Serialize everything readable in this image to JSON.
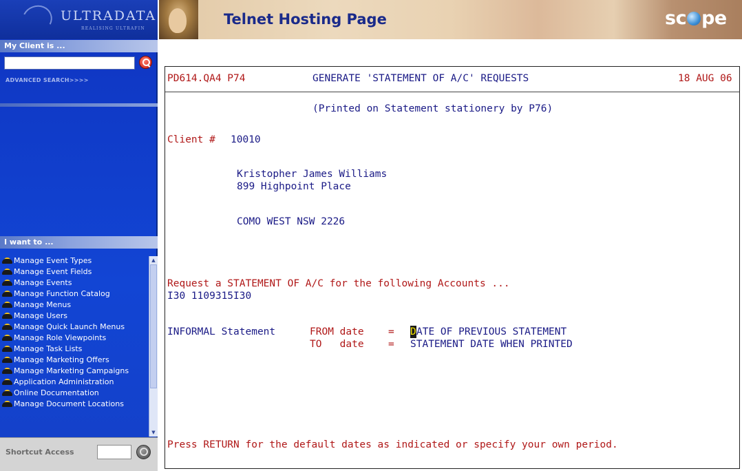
{
  "sidebar": {
    "logo": {
      "name": "ULTRADATA",
      "tagline": "REALISING ULTRAFIN"
    },
    "client_header": "My Client is ...",
    "search_input_value": "",
    "advanced_search_label": "ADVANCED SEARCH>>>>",
    "want_header": "I want to ...",
    "menu_items": [
      {
        "label": "Manage Event Types"
      },
      {
        "label": "Manage Event Fields"
      },
      {
        "label": "Manage Events"
      },
      {
        "label": "Manage Function Catalog"
      },
      {
        "label": "Manage Menus"
      },
      {
        "label": "Manage Users"
      },
      {
        "label": "Manage Quick Launch Menus"
      },
      {
        "label": "Manage Role Viewpoints"
      },
      {
        "label": "Manage Task Lists"
      },
      {
        "label": "Manage Marketing Offers"
      },
      {
        "label": "Manage Marketing Campaigns"
      },
      {
        "label": "Application Administration"
      },
      {
        "label": "Online Documentation"
      },
      {
        "label": "Manage Document Locations"
      }
    ],
    "shortcut_label": "Shortcut Access",
    "shortcut_value": ""
  },
  "header": {
    "title": "Telnet Hosting Page",
    "brand_left": "sc",
    "brand_right": "pe"
  },
  "terminal": {
    "program_id": "PD614.QA4 P74",
    "screen_title": "GENERATE 'STATEMENT OF A/C' REQUESTS",
    "date": "18 AUG 06",
    "printed_note": "(Printed on Statement stationery by P76)",
    "client_label": "Client #",
    "client_number": "10010",
    "address": [
      "Kristopher James Williams",
      "899 Highpoint Place",
      "",
      "COMO WEST NSW 2226"
    ],
    "request_text": "Request a STATEMENT OF A/C for the following Accounts ...",
    "account": "I30 1109315I30",
    "statement_type": "INFORMAL Statement",
    "from_label": "FROM date",
    "to_label": "TO   date",
    "equals": "=",
    "from_cursor_char": "D",
    "from_value_rest": "ATE OF PREVIOUS STATEMENT",
    "to_value": "STATEMENT DATE WHEN PRINTED",
    "footer_prompt": "Press RETURN for the default dates as indicated or specify your own period."
  },
  "colors": {
    "sidebar_blue": "#1245d4",
    "terminal_red": "#b01818",
    "terminal_blue": "#1a1a86",
    "header_title": "#1a2a8a"
  }
}
